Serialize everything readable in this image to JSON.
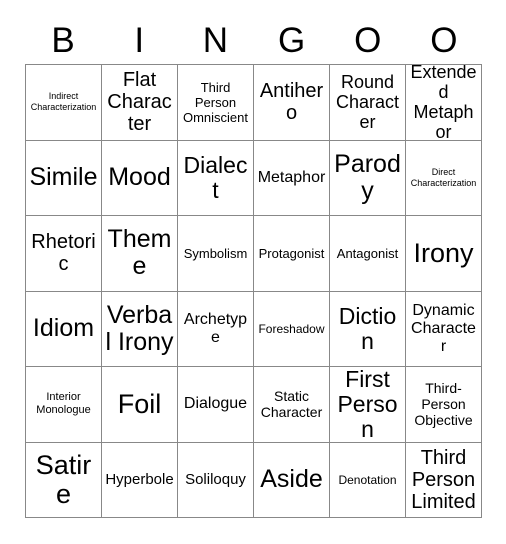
{
  "header": {
    "letters": [
      "B",
      "I",
      "N",
      "G",
      "O",
      "O"
    ]
  },
  "grid": {
    "columns": 6,
    "rows": 6,
    "border_color": "#888888",
    "background_color": "#ffffff",
    "text_color": "#000000",
    "cells": [
      {
        "label": "Indirect Characterization",
        "size": "fs-xs"
      },
      {
        "label": "Flat Character",
        "size": "fs-3xl"
      },
      {
        "label": "Third Person Omniscient",
        "size": "fs-m"
      },
      {
        "label": "Antihero",
        "size": "fs-3xl"
      },
      {
        "label": "Round Character",
        "size": "fs-2xl"
      },
      {
        "label": "Extended Metaphor",
        "size": "fs-2xl"
      },
      {
        "label": "Simile",
        "size": "fs-5xl"
      },
      {
        "label": "Mood",
        "size": "fs-5xl"
      },
      {
        "label": "Dialect",
        "size": "fs-4xl"
      },
      {
        "label": "Metaphor",
        "size": "fs-xl"
      },
      {
        "label": "Parody",
        "size": "fs-5xl"
      },
      {
        "label": "Direct Characterization",
        "size": "fs-xs"
      },
      {
        "label": "Rhetoric",
        "size": "fs-3xl"
      },
      {
        "label": "Theme",
        "size": "fs-5xl"
      },
      {
        "label": "Symbolism",
        "size": "fs-m"
      },
      {
        "label": "Protagonist",
        "size": "fs-m"
      },
      {
        "label": "Antagonist",
        "size": "fs-m"
      },
      {
        "label": "Irony",
        "size": "fs-6xl"
      },
      {
        "label": "Idiom",
        "size": "fs-5xl"
      },
      {
        "label": "Verbal Irony",
        "size": "fs-5xl"
      },
      {
        "label": "Archetype",
        "size": "fs-xl"
      },
      {
        "label": "Foreshadow",
        "size": "fs-sm"
      },
      {
        "label": "Diction",
        "size": "fs-4xl"
      },
      {
        "label": "Dynamic Character",
        "size": "fs-xl"
      },
      {
        "label": "Interior Monologue",
        "size": "fs-s"
      },
      {
        "label": "Foil",
        "size": "fs-6xl"
      },
      {
        "label": "Dialogue",
        "size": "fs-xl"
      },
      {
        "label": "Static Character",
        "size": "fs-ml"
      },
      {
        "label": "First Person",
        "size": "fs-4xl"
      },
      {
        "label": "Third-Person Objective",
        "size": "fs-ml"
      },
      {
        "label": "Satire",
        "size": "fs-6xl"
      },
      {
        "label": "Hyperbole",
        "size": "fs-l"
      },
      {
        "label": "Soliloquy",
        "size": "fs-l"
      },
      {
        "label": "Aside",
        "size": "fs-5xl"
      },
      {
        "label": "Denotation",
        "size": "fs-sm"
      },
      {
        "label": "Third Person Limited",
        "size": "fs-3xl"
      }
    ]
  }
}
